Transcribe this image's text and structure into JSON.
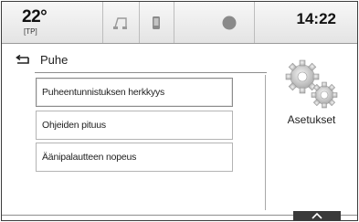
{
  "status_bar": {
    "temperature": "22°",
    "source": "[TP]",
    "time": "14:22",
    "icons": [
      "music-note-icon",
      "phone-icon",
      "circle-icon"
    ]
  },
  "page": {
    "title": "Puhe"
  },
  "menu": {
    "items": [
      {
        "label": "Puheentunnistuksen herkkyys",
        "selected": true
      },
      {
        "label": "Ohjeiden pituus",
        "selected": false
      },
      {
        "label": "Äänipalautteen nopeus",
        "selected": false
      }
    ]
  },
  "settings": {
    "label": "Asetukset",
    "icon": "gears-icon"
  },
  "bottom": {
    "icon": "chevron-up-icon"
  }
}
